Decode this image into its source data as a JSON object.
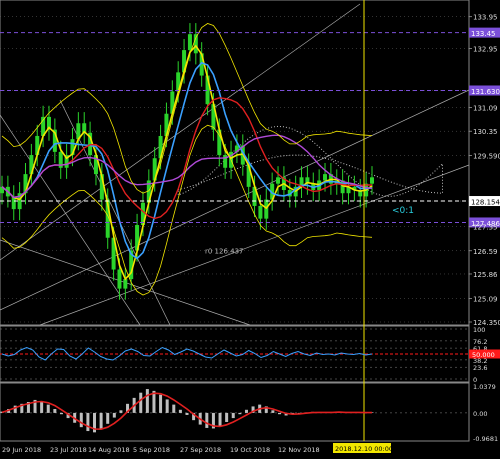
{
  "chart_data": [
    {
      "type": "candlestick",
      "panel": "main",
      "y_axis_ticks": [
        "133.95",
        "132.95",
        "131.630",
        "131.09",
        "130.35",
        "129.590",
        "128.154",
        "127.35",
        "126.59",
        "125.86",
        "125.09",
        "124.350"
      ],
      "ylim": [
        124.35,
        134.35
      ],
      "highlighted_levels": [
        {
          "value": 133.45,
          "label": "133.45",
          "color": "#7b4fd9"
        },
        {
          "value": 131.63,
          "label": "131.630",
          "color": "#7b4fd9"
        },
        {
          "value": 128.154,
          "label": "128.154",
          "color": "#ffffff"
        },
        {
          "value": 127.48,
          "label": "127.486",
          "color": "#7b4fd9"
        }
      ],
      "annotations": [
        "r0 126.437",
        "<0:1"
      ],
      "x_tick_labels": [
        "29 Jun 2018",
        "23 Jul 2018",
        "14 Aug 2018",
        "5 Sep 2018",
        "27 Sep 2018",
        "19 Oct 2018",
        "12 Nov 2018",
        "2018.12.10 00:00"
      ],
      "cursor_label": "2018.12.10 00:00",
      "close": [
        128.6,
        128.3,
        127.9,
        128.4,
        129.0,
        129.6,
        130.2,
        130.8,
        130.4,
        129.7,
        129.2,
        129.6,
        130.1,
        130.6,
        130.3,
        129.6,
        129.0,
        128.2,
        127.0,
        126.0,
        125.4,
        125.7,
        126.6,
        127.4,
        128.1,
        128.8,
        129.5,
        130.2,
        130.9,
        131.6,
        132.2,
        132.9,
        133.4,
        132.8,
        132.1,
        131.2,
        130.4,
        129.6,
        129.2,
        129.7,
        129.9,
        129.3,
        128.6,
        128.0,
        127.6,
        128.2,
        128.7,
        128.9,
        128.5,
        128.3,
        128.6,
        128.9,
        128.7,
        128.5,
        128.8,
        129.0,
        128.7,
        128.8,
        128.4,
        128.6,
        128.5,
        128.3,
        128.7,
        128.9
      ]
    },
    {
      "type": "line",
      "panel": "indicator-1",
      "y_axis_ticks": [
        "100",
        "76.2",
        "61.8",
        "50.0",
        "38.2",
        "23.6",
        "0"
      ],
      "highlighted_levels": [
        {
          "value": 50.0,
          "label": "50.000",
          "color": "#ff1a1a"
        }
      ],
      "ylim": [
        0,
        100
      ],
      "values": [
        50,
        46,
        49,
        58,
        63,
        58,
        44,
        38,
        50,
        60,
        59,
        46,
        40,
        50,
        62,
        54,
        45,
        40,
        38,
        46,
        56,
        60,
        55,
        47,
        46,
        55,
        63,
        58,
        49,
        54,
        60,
        56,
        50,
        44,
        42,
        50,
        58,
        52,
        46,
        49,
        57,
        51,
        43,
        47,
        55,
        50,
        45,
        51,
        55,
        50,
        47,
        52,
        49,
        50,
        48,
        52,
        50,
        49,
        51,
        48,
        50
      ]
    },
    {
      "type": "bar",
      "panel": "indicator-2",
      "y_axis_ticks": [
        "1.0379",
        "0.00",
        "-0.9681"
      ],
      "ylim": [
        -0.9681,
        1.0379
      ],
      "histogram": [
        0.05,
        0.15,
        0.28,
        0.35,
        0.42,
        0.5,
        0.45,
        0.32,
        0.15,
        -0.05,
        -0.2,
        -0.38,
        -0.55,
        -0.7,
        -0.75,
        -0.62,
        -0.42,
        -0.18,
        0.1,
        0.35,
        0.58,
        0.78,
        0.92,
        0.85,
        0.7,
        0.52,
        0.32,
        0.12,
        -0.08,
        -0.28,
        -0.45,
        -0.58,
        -0.6,
        -0.5,
        -0.35,
        -0.2,
        -0.05,
        0.12,
        0.25,
        0.32,
        0.25,
        0.1,
        -0.05,
        -0.1,
        -0.06,
        -0.02,
        0.02,
        0.04,
        0.03,
        0.02,
        0.03,
        0.04,
        0.02,
        0.03,
        0.02,
        0.01,
        0.02
      ],
      "signal": [
        0.02,
        0.1,
        0.2,
        0.29,
        0.36,
        0.42,
        0.44,
        0.39,
        0.28,
        0.12,
        -0.05,
        -0.22,
        -0.38,
        -0.52,
        -0.62,
        -0.63,
        -0.55,
        -0.4,
        -0.2,
        0.05,
        0.28,
        0.5,
        0.68,
        0.76,
        0.74,
        0.65,
        0.5,
        0.33,
        0.15,
        -0.05,
        -0.24,
        -0.4,
        -0.5,
        -0.52,
        -0.46,
        -0.35,
        -0.22,
        -0.08,
        0.06,
        0.16,
        0.2,
        0.15,
        0.06,
        -0.02,
        -0.05,
        -0.04,
        -0.01,
        0.01,
        0.02,
        0.02,
        0.02,
        0.03,
        0.02,
        0.02,
        0.02,
        0.01,
        0.01
      ]
    }
  ],
  "colors": {
    "background": "#000000",
    "bull_candle": "#2bd42b",
    "ma_red": "#e02020",
    "ma_blue": "#3aa0ff",
    "ma_purple": "#b04ad8",
    "ma_yellow": "#f2e600",
    "cloud": "#ffffff",
    "grid": "#666666",
    "cursor": "#f2e600",
    "level_purple": "#7b4fd9",
    "signal_red": "#e02020"
  }
}
